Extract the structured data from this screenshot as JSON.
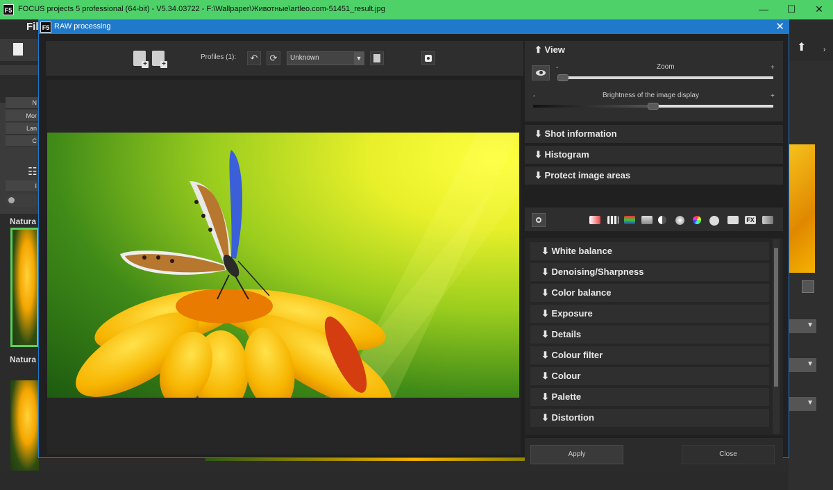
{
  "app": {
    "title": "FOCUS projects 5 professional (64-bit) - V5.34.03722 - F:\\Wallpaper\\Животные\\artleo.com-51451_result.jpg",
    "logo": "F5",
    "minimize_icon": "—",
    "maximize_icon": "☐",
    "close_icon": "✕",
    "menu_partial": "Fil",
    "left_rows": [
      "N",
      "Mor",
      "Lan",
      "C",
      "I"
    ],
    "thumb_labels": [
      "Natura",
      "Natura"
    ]
  },
  "dialog": {
    "title": "RAW processing",
    "logo": "F5",
    "close_icon": "✕"
  },
  "toolbar": {
    "profiles_label": "Profiles (1):",
    "profile_value": "Unknown",
    "undo_icon": "↶",
    "refresh_icon": "⟳"
  },
  "view": {
    "header": "View",
    "header_arrow": "⬆",
    "zoom_label": "Zoom",
    "zoom_level": 0.0,
    "brightness_label": "Brightness of the image display",
    "brightness_level": 0.5,
    "minus": "-",
    "plus": "+"
  },
  "sections": [
    {
      "label": "Shot information",
      "arrow": "⬇"
    },
    {
      "label": "Histogram",
      "arrow": "⬇"
    },
    {
      "label": "Protect image areas",
      "arrow": "⬇"
    }
  ],
  "adjustments": [
    {
      "label": "White balance",
      "arrow": "⬇"
    },
    {
      "label": "Denoising/Sharpness",
      "arrow": "⬇"
    },
    {
      "label": "Color balance",
      "arrow": "⬇"
    },
    {
      "label": "Exposure",
      "arrow": "⬇"
    },
    {
      "label": "Details",
      "arrow": "⬇"
    },
    {
      "label": "Colour filter",
      "arrow": "⬇"
    },
    {
      "label": "Colour",
      "arrow": "⬇"
    },
    {
      "label": "Palette",
      "arrow": "⬇"
    },
    {
      "label": "Distortion",
      "arrow": "⬇"
    }
  ],
  "tool_icons": [
    "gradient-icon",
    "grid-icon",
    "color-bars-icon",
    "landscape-icon",
    "contrast-icon",
    "circle-icon",
    "color-wheel-icon",
    "palette-icon",
    "camera-icon",
    "fx-icon",
    "layers-icon"
  ],
  "footer": {
    "apply_label": "Apply",
    "close_label": "Close"
  },
  "colors": {
    "app_titlebar": "#4fd16a",
    "dialog_titlebar": "#1f7acb",
    "panel_bg": "#2e2e2e"
  }
}
